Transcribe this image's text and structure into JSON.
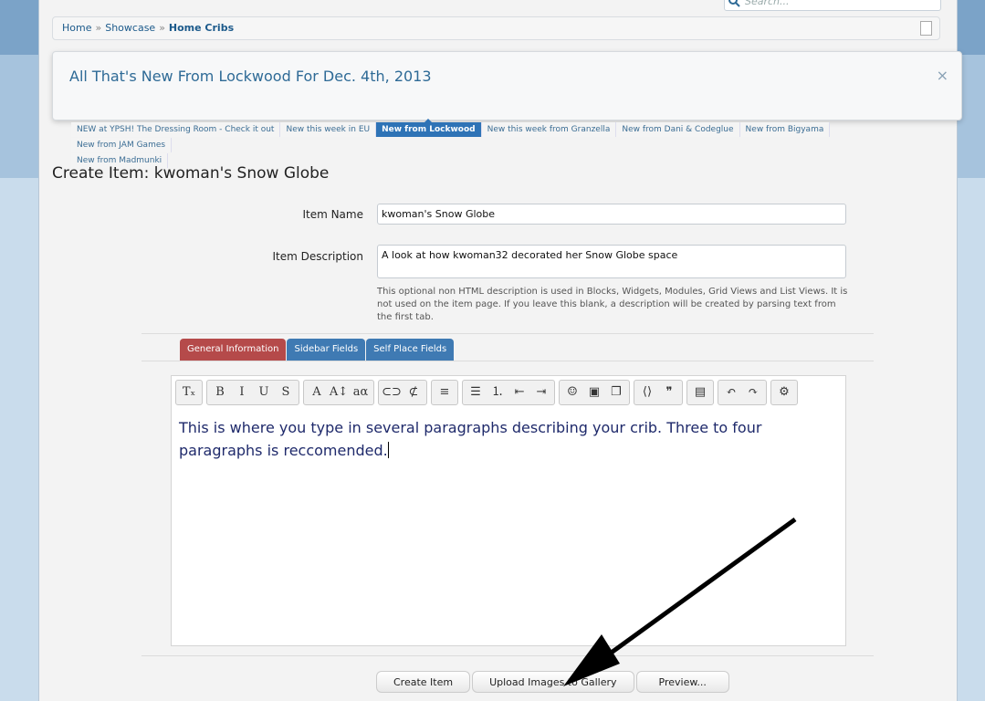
{
  "search": {
    "placeholder": "Search..."
  },
  "breadcrumb": {
    "items": [
      "Home",
      "Showcase"
    ],
    "current": "Home Cribs",
    "separator": "»"
  },
  "notice": {
    "title": "All That's New From Lockwood For Dec. 4th, 2013",
    "close_glyph": "×",
    "tabs": [
      "NEW at YPSH! The Dressing Room - Check it out",
      "New this week in EU",
      "New from Lockwood",
      "New this week from Granzella",
      "New from Dani & Codeglue",
      "New from Bigyama",
      "New from JAM Games",
      "New from Madmunki"
    ],
    "active_tab": "New from Lockwood"
  },
  "page": {
    "heading": "Create Item: kwoman's Snow Globe"
  },
  "form": {
    "item_name_label": "Item Name",
    "item_name_value": "kwoman's Snow Globe",
    "item_description_label": "Item Description",
    "item_description_value": "A look at how kwoman32 decorated her Snow Globe space",
    "help_text": "This optional non HTML description is used in Blocks, Widgets, Modules, Grid Views and List Views. It is not used on the item page. If you leave this blank, a description will be created by parsing text from the first tab."
  },
  "editor_tabs": [
    {
      "label": "General Information",
      "active": true
    },
    {
      "label": "Sidebar Fields",
      "active": false
    },
    {
      "label": "Self Place Fields",
      "active": false
    }
  ],
  "editor": {
    "content": "This is where you type in several paragraphs describing your crib.  Three to four paragraphs is reccomended.",
    "toolbar_icons": [
      [
        "remove-format-icon"
      ],
      [
        "bold-icon",
        "italic-icon",
        "underline-icon",
        "strikethrough-icon"
      ],
      [
        "text-color-icon",
        "font-size-icon",
        "font-family-icon"
      ],
      [
        "link-icon",
        "unlink-icon"
      ],
      [
        "align-icon"
      ],
      [
        "bulleted-list-icon",
        "numbered-list-icon",
        "outdent-icon",
        "indent-icon"
      ],
      [
        "smiley-icon",
        "image-icon",
        "media-icon"
      ],
      [
        "source-icon",
        "quote-icon"
      ],
      [
        "save-draft-icon"
      ],
      [
        "undo-icon",
        "redo-icon"
      ],
      [
        "toggle-bbcode-icon"
      ]
    ],
    "toolbar_glyphs": {
      "remove-format-icon": "Tₓ",
      "bold-icon": "B",
      "italic-icon": "I",
      "underline-icon": "U",
      "strikethrough-icon": "S",
      "text-color-icon": "A",
      "font-size-icon": "A↕",
      "font-family-icon": "aα",
      "link-icon": "⊂⊃",
      "unlink-icon": "⊄",
      "align-icon": "≡",
      "bulleted-list-icon": "☰",
      "numbered-list-icon": "⒈",
      "outdent-icon": "⇤",
      "indent-icon": "⇥",
      "smiley-icon": "☺",
      "image-icon": "▣",
      "media-icon": "❐",
      "source-icon": "⟨⟩",
      "quote-icon": "❞",
      "save-draft-icon": "▤",
      "undo-icon": "↶",
      "redo-icon": "↷",
      "toggle-bbcode-icon": "⚙"
    }
  },
  "buttons": {
    "create": "Create Item",
    "upload": "Upload Images to Gallery",
    "preview": "Preview..."
  }
}
